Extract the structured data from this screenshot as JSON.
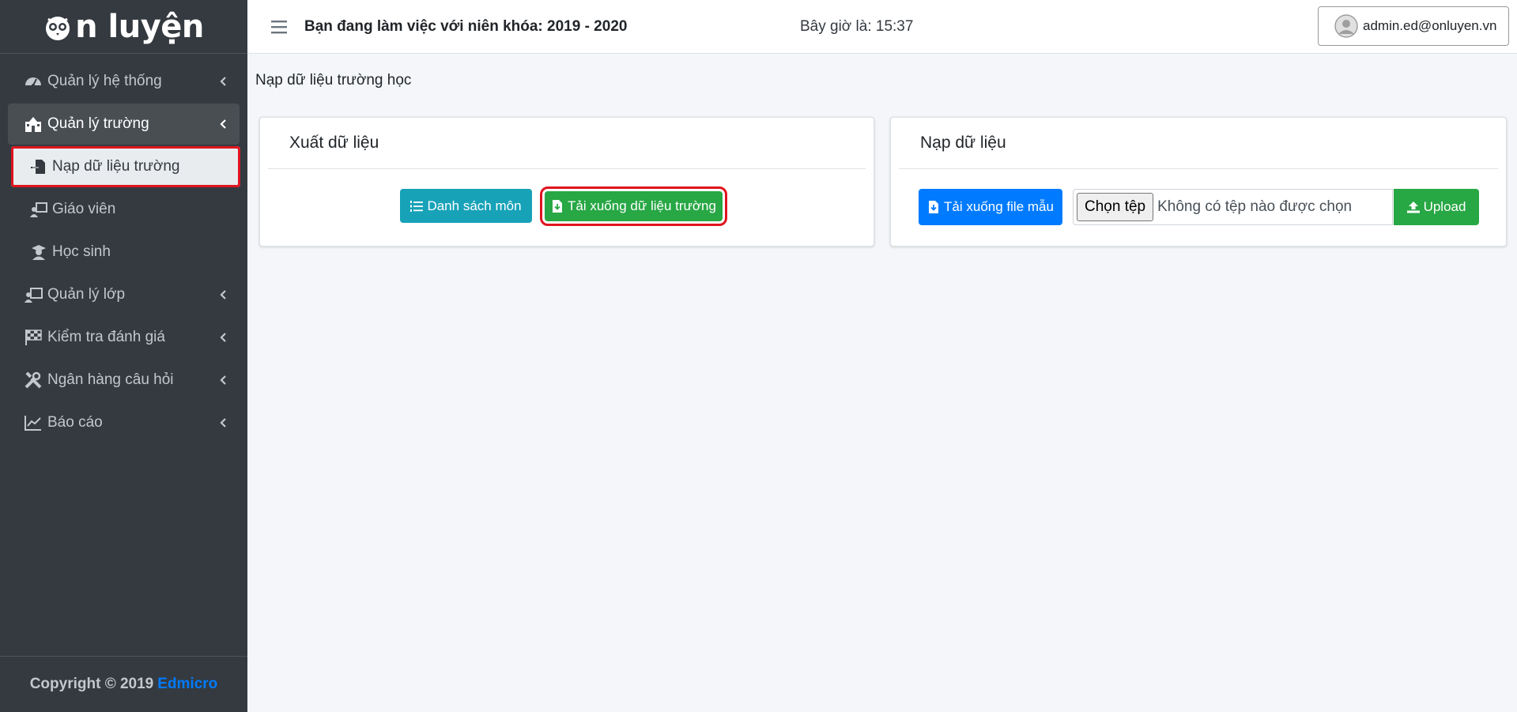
{
  "sidebar": {
    "brand": "n luyện",
    "menu": [
      {
        "label": "Quản lý hệ thống"
      },
      {
        "label": "Quản lý trường"
      },
      {
        "label": "Quản lý lớp"
      },
      {
        "label": "Kiểm tra đánh giá"
      },
      {
        "label": "Ngân hàng câu hỏi"
      },
      {
        "label": "Báo cáo"
      }
    ],
    "submenu": [
      {
        "label": "Nạp dữ liệu trường"
      },
      {
        "label": "Giáo viên"
      },
      {
        "label": "Học sinh"
      }
    ],
    "footer": {
      "text": "Copyright © 2019",
      "link": "Edmicro"
    }
  },
  "header": {
    "title": "Bạn đang làm việc với niên khóa: 2019 - 2020",
    "time": "Bây giờ là: 15:37",
    "user_email": "admin.ed@onluyen.vn"
  },
  "page": {
    "title": "Nạp dữ liệu trường học"
  },
  "export_card": {
    "title": "Xuất dữ liệu",
    "subjects_button": "Danh sách môn",
    "download_school_button": "Tải xuống dữ liệu trường"
  },
  "import_card": {
    "title": "Nạp dữ liệu",
    "template_button": "Tải xuống file mẫu",
    "choose_file": "Chọn tệp",
    "no_file": "Không có tệp nào được chọn",
    "upload_button": "Upload"
  },
  "colors": {
    "sidebar_bg": "#343a40",
    "info": "#17a2b8",
    "success": "#28a745",
    "primary": "#007bff",
    "highlight": "#e0141e"
  }
}
